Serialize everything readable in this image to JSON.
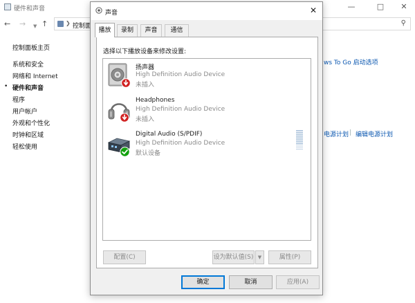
{
  "background_window": {
    "title": "硬件和声音",
    "address_crumb": "控制面",
    "sidebar": [
      {
        "label": "控制面板主页",
        "active": false
      },
      {
        "label": "系统和安全",
        "active": false
      },
      {
        "label": "网络和 Internet",
        "active": false
      },
      {
        "label": "硬件和声音",
        "active": true
      },
      {
        "label": "程序",
        "active": false
      },
      {
        "label": "用户帐户",
        "active": false
      },
      {
        "label": "外观和个性化",
        "active": false
      },
      {
        "label": "时钟和区域",
        "active": false
      },
      {
        "label": "轻松使用",
        "active": false
      }
    ],
    "links": {
      "windows_to_go": "ws To Go 启动选项",
      "power_plan": "电源计划",
      "edit_power_plan": "编辑电源计划",
      "separator": "|"
    },
    "active_bullet": "•"
  },
  "dialog": {
    "title": "声音",
    "tabs": [
      {
        "label": "播放",
        "active": true
      },
      {
        "label": "录制",
        "active": false
      },
      {
        "label": "声音",
        "active": false
      },
      {
        "label": "通信",
        "active": false
      }
    ],
    "instruction": "选择以下播放设备来修改设置:",
    "devices": [
      {
        "name": "扬声器",
        "driver": "High Definition Audio Device",
        "status": "未插入",
        "icon": "speaker-icon",
        "badge": "unplugged-badge-icon"
      },
      {
        "name": "Headphones",
        "driver": "High Definition Audio Device",
        "status": "未插入",
        "icon": "headphones-icon",
        "badge": "unplugged-badge-icon"
      },
      {
        "name": "Digital Audio (S/PDIF)",
        "driver": "High Definition Audio Device",
        "status": "默认设备",
        "icon": "digital-audio-icon",
        "badge": "default-check-icon"
      }
    ],
    "buttons": {
      "configure": "配置(C)",
      "set_default": "设为默认值(S)",
      "properties": "属性(P)",
      "ok": "确定",
      "cancel": "取消",
      "apply": "应用(A)"
    }
  },
  "colors": {
    "accent": "#0078d7",
    "link": "#0b57b0",
    "unplugged_badge": "#d02020",
    "default_badge": "#13a10e"
  }
}
